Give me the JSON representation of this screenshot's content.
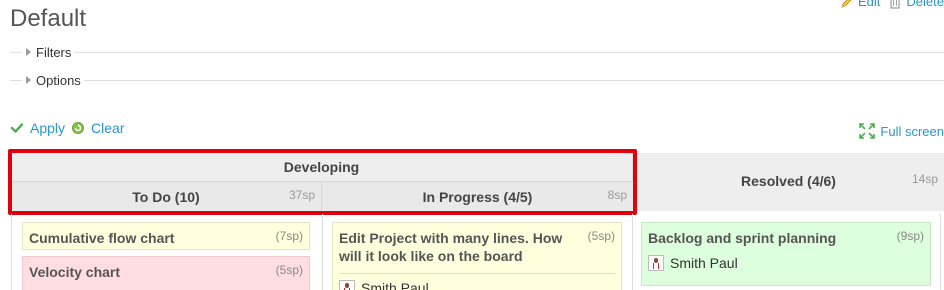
{
  "page": {
    "title": "Default"
  },
  "top_actions": {
    "edit_label": "Edit",
    "delete_label": "Delete"
  },
  "filters": {
    "legend": "Filters"
  },
  "options": {
    "legend": "Options"
  },
  "buttons": {
    "apply_label": "Apply",
    "clear_label": "Clear"
  },
  "fullscreen": {
    "label": "Full screen"
  },
  "board": {
    "group": {
      "name": "Developing"
    },
    "columns": [
      {
        "name": "To Do (10)",
        "sp": "37sp"
      },
      {
        "name": "In Progress (4/5)",
        "sp": "8sp"
      },
      {
        "name": "Resolved (4/6)",
        "sp": "14sp"
      }
    ],
    "cards": [
      {
        "title": "Cumulative flow chart",
        "sp": "(7sp)",
        "color": "#ffffdd"
      },
      {
        "title": "Velocity chart",
        "sp": "(5sp)",
        "color": "#ffdde3"
      },
      {
        "title": "Edit Project with many lines. How will it look like on the board",
        "sp": "(5sp)",
        "assignee": "Smith Paul",
        "color": "#ffffdd"
      },
      {
        "title": "Backlog and sprint planning",
        "sp": "(9sp)",
        "assignee": "Smith Paul",
        "color": "#ddffdd"
      }
    ]
  },
  "colors": {
    "link": "#2996cc",
    "highlight": "#e0000d",
    "header_bg": "#eeeeee"
  },
  "icons": {
    "edit": "pencil-icon",
    "delete": "trash-icon",
    "apply": "checkmark-icon",
    "clear": "reload-icon",
    "fullscreen": "fullscreen-icon",
    "avatar": "user-avatar-icon"
  }
}
